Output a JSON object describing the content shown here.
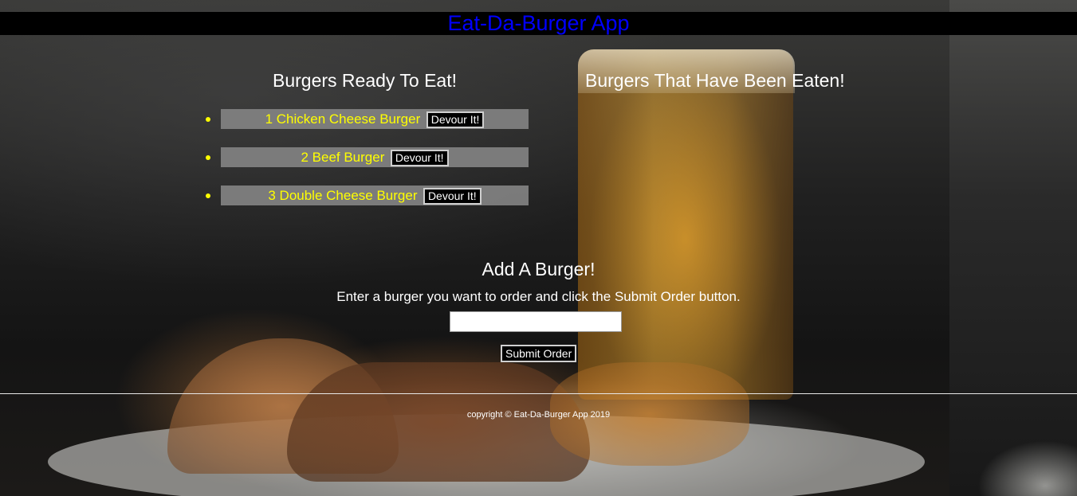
{
  "header": {
    "title": "Eat-Da-Burger App"
  },
  "ready": {
    "title": "Burgers Ready To Eat!",
    "items": [
      {
        "label": "1 Chicken Cheese Burger",
        "button": "Devour It!"
      },
      {
        "label": "2 Beef Burger",
        "button": "Devour It!"
      },
      {
        "label": "3 Double Cheese Burger",
        "button": "Devour It!"
      }
    ]
  },
  "eaten": {
    "title": "Burgers That Have Been Eaten!",
    "items": []
  },
  "add": {
    "title": "Add A Burger!",
    "instructions": "Enter a burger you want to order and click the Submit Order button.",
    "input_value": "",
    "submit_label": "Submit Order"
  },
  "footer": {
    "text": "copyright © Eat-Da-Burger App 2019"
  },
  "colors": {
    "header_bg": "#000000",
    "title_color": "#0000ff",
    "item_text": "#ffff00",
    "item_bar": "#808080"
  },
  "background": {
    "description_icon": "burger-and-beer-photo"
  }
}
